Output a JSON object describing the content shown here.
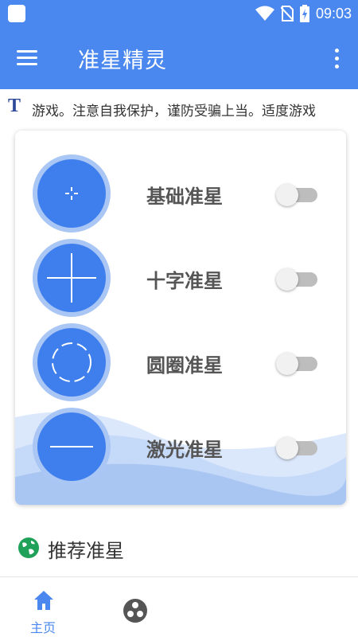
{
  "status_bar": {
    "time": "09:03",
    "icons": [
      "app-square-icon",
      "wifi-icon",
      "no-sim-icon",
      "battery-charging-icon"
    ]
  },
  "app_bar": {
    "title": "准星精灵",
    "menu_icon": "menu-icon",
    "more_icon": "more-vert-icon"
  },
  "notice": {
    "icon": "T",
    "text": "游戏。注意自我保护，谨防受骗上当。适度游戏"
  },
  "crosshairs": [
    {
      "label": "基础准星",
      "style": "basic",
      "enabled": false
    },
    {
      "label": "十字准星",
      "style": "cross",
      "enabled": false
    },
    {
      "label": "圆圈准星",
      "style": "circle",
      "enabled": false
    },
    {
      "label": "激光准星",
      "style": "laser",
      "enabled": false
    }
  ],
  "recommended": {
    "title": "推荐准星",
    "icon": "globe-icon"
  },
  "bottom_nav": {
    "home_label": "主页",
    "home_icon": "home-icon",
    "game_icon": "game-icon"
  },
  "colors": {
    "primary": "#4a88ef",
    "crosshair_fill": "#3f7fed",
    "crosshair_ring": "#a9c6f5",
    "globe_green": "#1fa15a",
    "switch_off": "#bdbdbd"
  }
}
